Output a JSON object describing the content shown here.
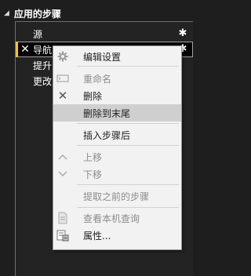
{
  "panel": {
    "title": "应用的步骤",
    "collapse_icon": "triangle-down-icon"
  },
  "steps": [
    {
      "label": "源",
      "has_gear": true
    },
    {
      "label": "导航",
      "has_gear": true,
      "selected": true
    },
    {
      "label": "提升",
      "has_gear": false
    },
    {
      "label": "更改",
      "has_gear": false
    }
  ],
  "context_menu": {
    "items": [
      {
        "label": "编辑设置",
        "icon": "gear-icon",
        "disabled": false
      },
      {
        "label": "重命名",
        "icon": "rename-icon",
        "disabled": true
      },
      {
        "label": "删除",
        "icon": "delete-x-icon",
        "disabled": false
      },
      {
        "label": "删除到末尾",
        "icon": "",
        "disabled": false,
        "highlighted": true
      },
      {
        "label": "插入步骤后",
        "icon": "",
        "disabled": false
      },
      {
        "label": "上移",
        "icon": "arrow-up-icon",
        "disabled": true
      },
      {
        "label": "下移",
        "icon": "arrow-down-icon",
        "disabled": true
      },
      {
        "label": "提取之前的步骤",
        "icon": "",
        "disabled": true
      },
      {
        "label": "查看本机查询",
        "icon": "query-doc-icon",
        "disabled": true
      },
      {
        "label": "属性...",
        "icon": "properties-icon",
        "disabled": false
      }
    ]
  },
  "colors": {
    "background": "#1e1e1e",
    "selected_accent": "#f2c811",
    "menu_bg": "#f2f2f2",
    "menu_hover": "#cfcfcf"
  }
}
